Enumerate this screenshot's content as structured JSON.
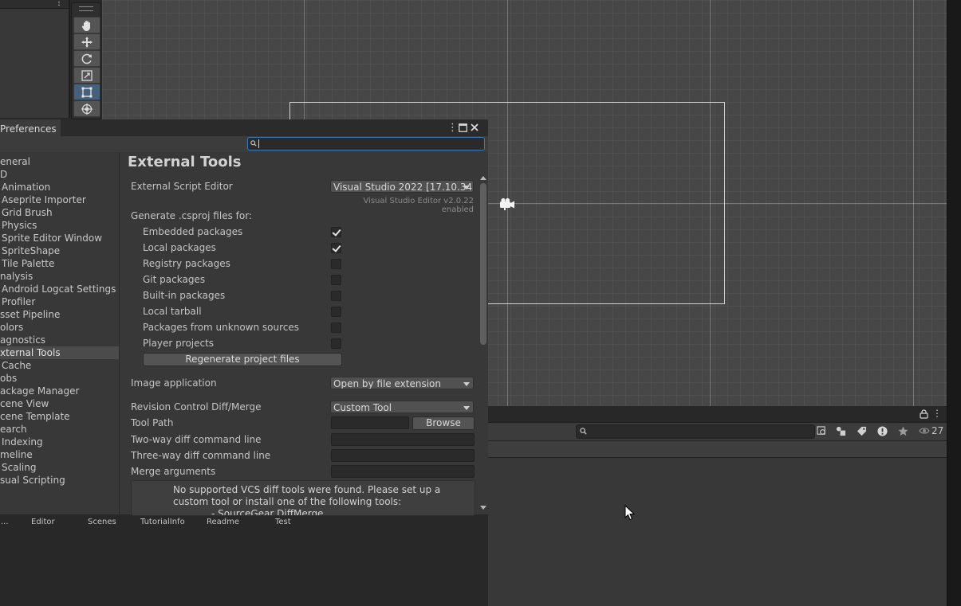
{
  "preferences": {
    "window_title": "Preferences",
    "search_placeholder": "",
    "sidebar_items": [
      {
        "label": "eneral",
        "selected": false
      },
      {
        "label": "D",
        "selected": false
      },
      {
        "label": "Animation",
        "selected": false
      },
      {
        "label": "Aseprite Importer",
        "selected": false
      },
      {
        "label": "Grid Brush",
        "selected": false
      },
      {
        "label": "Physics",
        "selected": false
      },
      {
        "label": "Sprite Editor Window",
        "selected": false
      },
      {
        "label": "SpriteShape",
        "selected": false
      },
      {
        "label": "Tile Palette",
        "selected": false
      },
      {
        "label": "nalysis",
        "selected": false
      },
      {
        "label": "Android Logcat Settings",
        "selected": false
      },
      {
        "label": "Profiler",
        "selected": false
      },
      {
        "label": "sset Pipeline",
        "selected": false
      },
      {
        "label": "olors",
        "selected": false
      },
      {
        "label": "agnostics",
        "selected": false
      },
      {
        "label": "xternal Tools",
        "selected": true
      },
      {
        "label": "Cache",
        "selected": false
      },
      {
        "label": "obs",
        "selected": false
      },
      {
        "label": "ackage Manager",
        "selected": false
      },
      {
        "label": "cene View",
        "selected": false
      },
      {
        "label": "cene Template",
        "selected": false
      },
      {
        "label": "earch",
        "selected": false
      },
      {
        "label": "Indexing",
        "selected": false
      },
      {
        "label": "meline",
        "selected": false
      },
      {
        "label": "Scaling",
        "selected": false
      },
      {
        "label": "sual Scripting",
        "selected": false
      }
    ],
    "content": {
      "title": "External Tools",
      "external_script_editor_label": "External Script Editor",
      "external_script_editor_value": "Visual Studio 2022 [17.10.34!",
      "editor_note": "Visual Studio Editor v2.0.22 enabled",
      "generate_label": "Generate .csproj files for:",
      "packages": [
        {
          "label": "Embedded packages",
          "checked": true
        },
        {
          "label": "Local packages",
          "checked": true
        },
        {
          "label": "Registry packages",
          "checked": false
        },
        {
          "label": "Git packages",
          "checked": false
        },
        {
          "label": "Built-in packages",
          "checked": false
        },
        {
          "label": "Local tarball",
          "checked": false
        },
        {
          "label": "Packages from unknown sources",
          "checked": false
        },
        {
          "label": "Player projects",
          "checked": false
        }
      ],
      "regenerate_button": "Regenerate project files",
      "image_app_label": "Image application",
      "image_app_value": "Open by file extension",
      "rc_label": "Revision Control Diff/Merge",
      "rc_value": "Custom Tool",
      "tool_path_label": "Tool Path",
      "browse_button": "Browse",
      "two_way_label": "Two-way diff command line",
      "three_way_label": "Three-way diff command line",
      "merge_label": "Merge arguments",
      "help_text": "No supported VCS diff tools were found. Please set up a custom tool or install one of the following tools:",
      "help_item": "- SourceGear DiffMerge"
    }
  },
  "bottom_tabs": [
    "...",
    "Editor",
    "Scenes",
    "TutorialInfo",
    "Readme",
    "Test"
  ],
  "project_panel": {
    "visible_count": "27",
    "search_placeholder": ""
  },
  "tools": [
    "hand-tool",
    "move-tool",
    "rotate-tool",
    "scale-tool",
    "rect-tool",
    "transform-tool"
  ],
  "colors": {
    "selection": "#46607c",
    "focus_border": "#3a79bb",
    "panel": "#383838",
    "scene": "#474747"
  }
}
